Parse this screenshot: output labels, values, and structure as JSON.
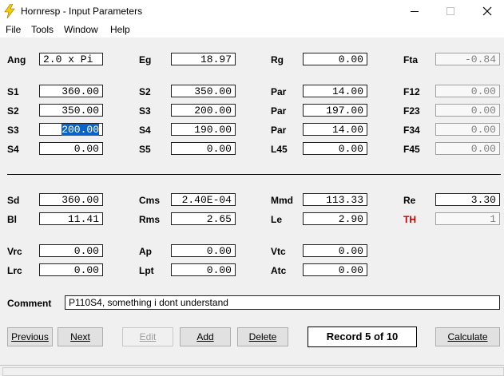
{
  "window": {
    "title": "Hornresp - Input Parameters"
  },
  "menu": [
    "File",
    "Tools",
    "Window",
    "Help"
  ],
  "rows": {
    "row1": [
      {
        "label": "Ang",
        "value": "2.0 x Pi"
      },
      {
        "label": "Eg",
        "value": "18.97"
      },
      {
        "label": "Rg",
        "value": "0.00"
      },
      {
        "label": "Fta",
        "value": "-0.84"
      }
    ],
    "row2": [
      {
        "label": "S1",
        "value": "360.00"
      },
      {
        "label": "S2",
        "value": "350.00"
      },
      {
        "label": "Par",
        "value": "14.00"
      },
      {
        "label": "F12",
        "value": "0.00"
      }
    ],
    "row3": [
      {
        "label": "S2",
        "value": "350.00"
      },
      {
        "label": "S3",
        "value": "200.00"
      },
      {
        "label": "Par",
        "value": "197.00"
      },
      {
        "label": "F23",
        "value": "0.00"
      }
    ],
    "row4": [
      {
        "label": "S3",
        "value": "200.00"
      },
      {
        "label": "S4",
        "value": "190.00"
      },
      {
        "label": "Par",
        "value": "14.00"
      },
      {
        "label": "F34",
        "value": "0.00"
      }
    ],
    "row5": [
      {
        "label": "S4",
        "value": "0.00"
      },
      {
        "label": "S5",
        "value": "0.00"
      },
      {
        "label": "L45",
        "value": "0.00"
      },
      {
        "label": "F45",
        "value": "0.00"
      }
    ],
    "row6": [
      {
        "label": "Sd",
        "value": "360.00"
      },
      {
        "label": "Cms",
        "value": "2.40E-04"
      },
      {
        "label": "Mmd",
        "value": "113.33"
      },
      {
        "label": "Re",
        "value": "3.30"
      }
    ],
    "row7": [
      {
        "label": "Bl",
        "value": "11.41"
      },
      {
        "label": "Rms",
        "value": "2.65"
      },
      {
        "label": "Le",
        "value": "2.90"
      },
      {
        "label": "TH",
        "value": "1"
      }
    ],
    "row8": [
      {
        "label": "Vrc",
        "value": "0.00"
      },
      {
        "label": "Ap",
        "value": "0.00"
      },
      {
        "label": "Vtc",
        "value": "0.00"
      }
    ],
    "row9": [
      {
        "label": "Lrc",
        "value": "0.00"
      },
      {
        "label": "Lpt",
        "value": "0.00"
      },
      {
        "label": "Atc",
        "value": "0.00"
      }
    ]
  },
  "comment": {
    "label": "Comment",
    "value": "P110S4, something i dont understand"
  },
  "buttons": {
    "previous": "Previous",
    "next": "Next",
    "edit": "Edit",
    "add": "Add",
    "delete": "Delete",
    "calculate": "Calculate"
  },
  "record": "Record 5 of 10",
  "colors": {
    "accent": "#0a64c8",
    "th_label": "#c00000"
  }
}
